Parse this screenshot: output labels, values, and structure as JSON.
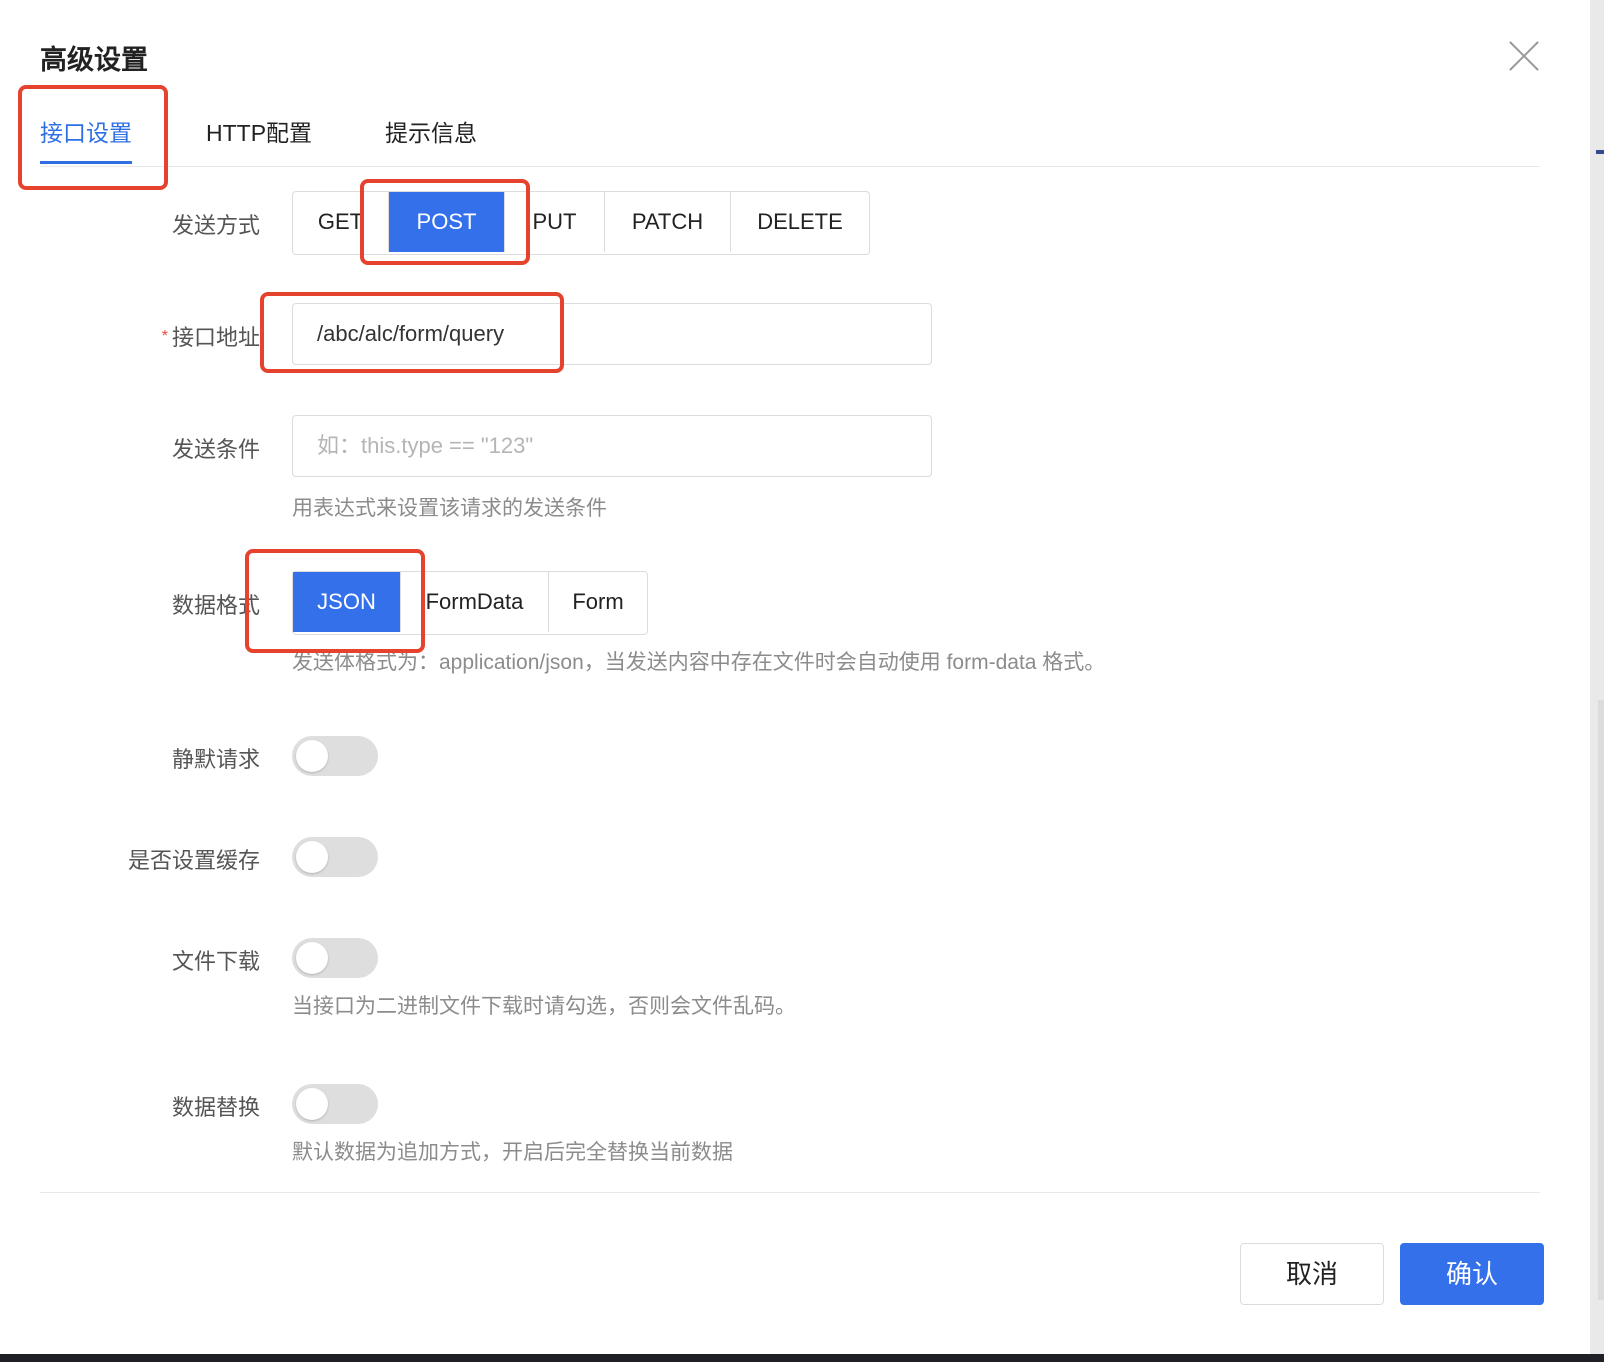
{
  "dialog": {
    "title": "高级设置",
    "close_icon": "close-icon"
  },
  "tabs": [
    {
      "label": "接口设置",
      "active": true
    },
    {
      "label": "HTTP配置",
      "active": false
    },
    {
      "label": "提示信息",
      "active": false
    }
  ],
  "form": {
    "method": {
      "label": "发送方式",
      "options": [
        "GET",
        "POST",
        "PUT",
        "PATCH",
        "DELETE"
      ],
      "selected": "POST"
    },
    "url": {
      "label": "接口地址",
      "required_mark": "*",
      "value": "/abc/alc/form/query"
    },
    "condition": {
      "label": "发送条件",
      "placeholder": "如：this.type == \"123\"",
      "hint": "用表达式来设置该请求的发送条件"
    },
    "format": {
      "label": "数据格式",
      "options": [
        "JSON",
        "FormData",
        "Form"
      ],
      "selected": "JSON",
      "hint": "发送体格式为：application/json，当发送内容中存在文件时会自动使用 form-data 格式。"
    },
    "silent": {
      "label": "静默请求",
      "on": false
    },
    "cache": {
      "label": "是否设置缓存",
      "on": false
    },
    "download": {
      "label": "文件下载",
      "on": false,
      "hint": "当接口为二进制文件下载时请勾选，否则会文件乱码。"
    },
    "replace": {
      "label": "数据替换",
      "on": false,
      "hint": "默认数据为追加方式，开启后完全替换当前数据"
    }
  },
  "footer": {
    "cancel_label": "取消",
    "confirm_label": "确认"
  },
  "colors": {
    "primary": "#3370ea",
    "annotation": "#e5432e"
  }
}
